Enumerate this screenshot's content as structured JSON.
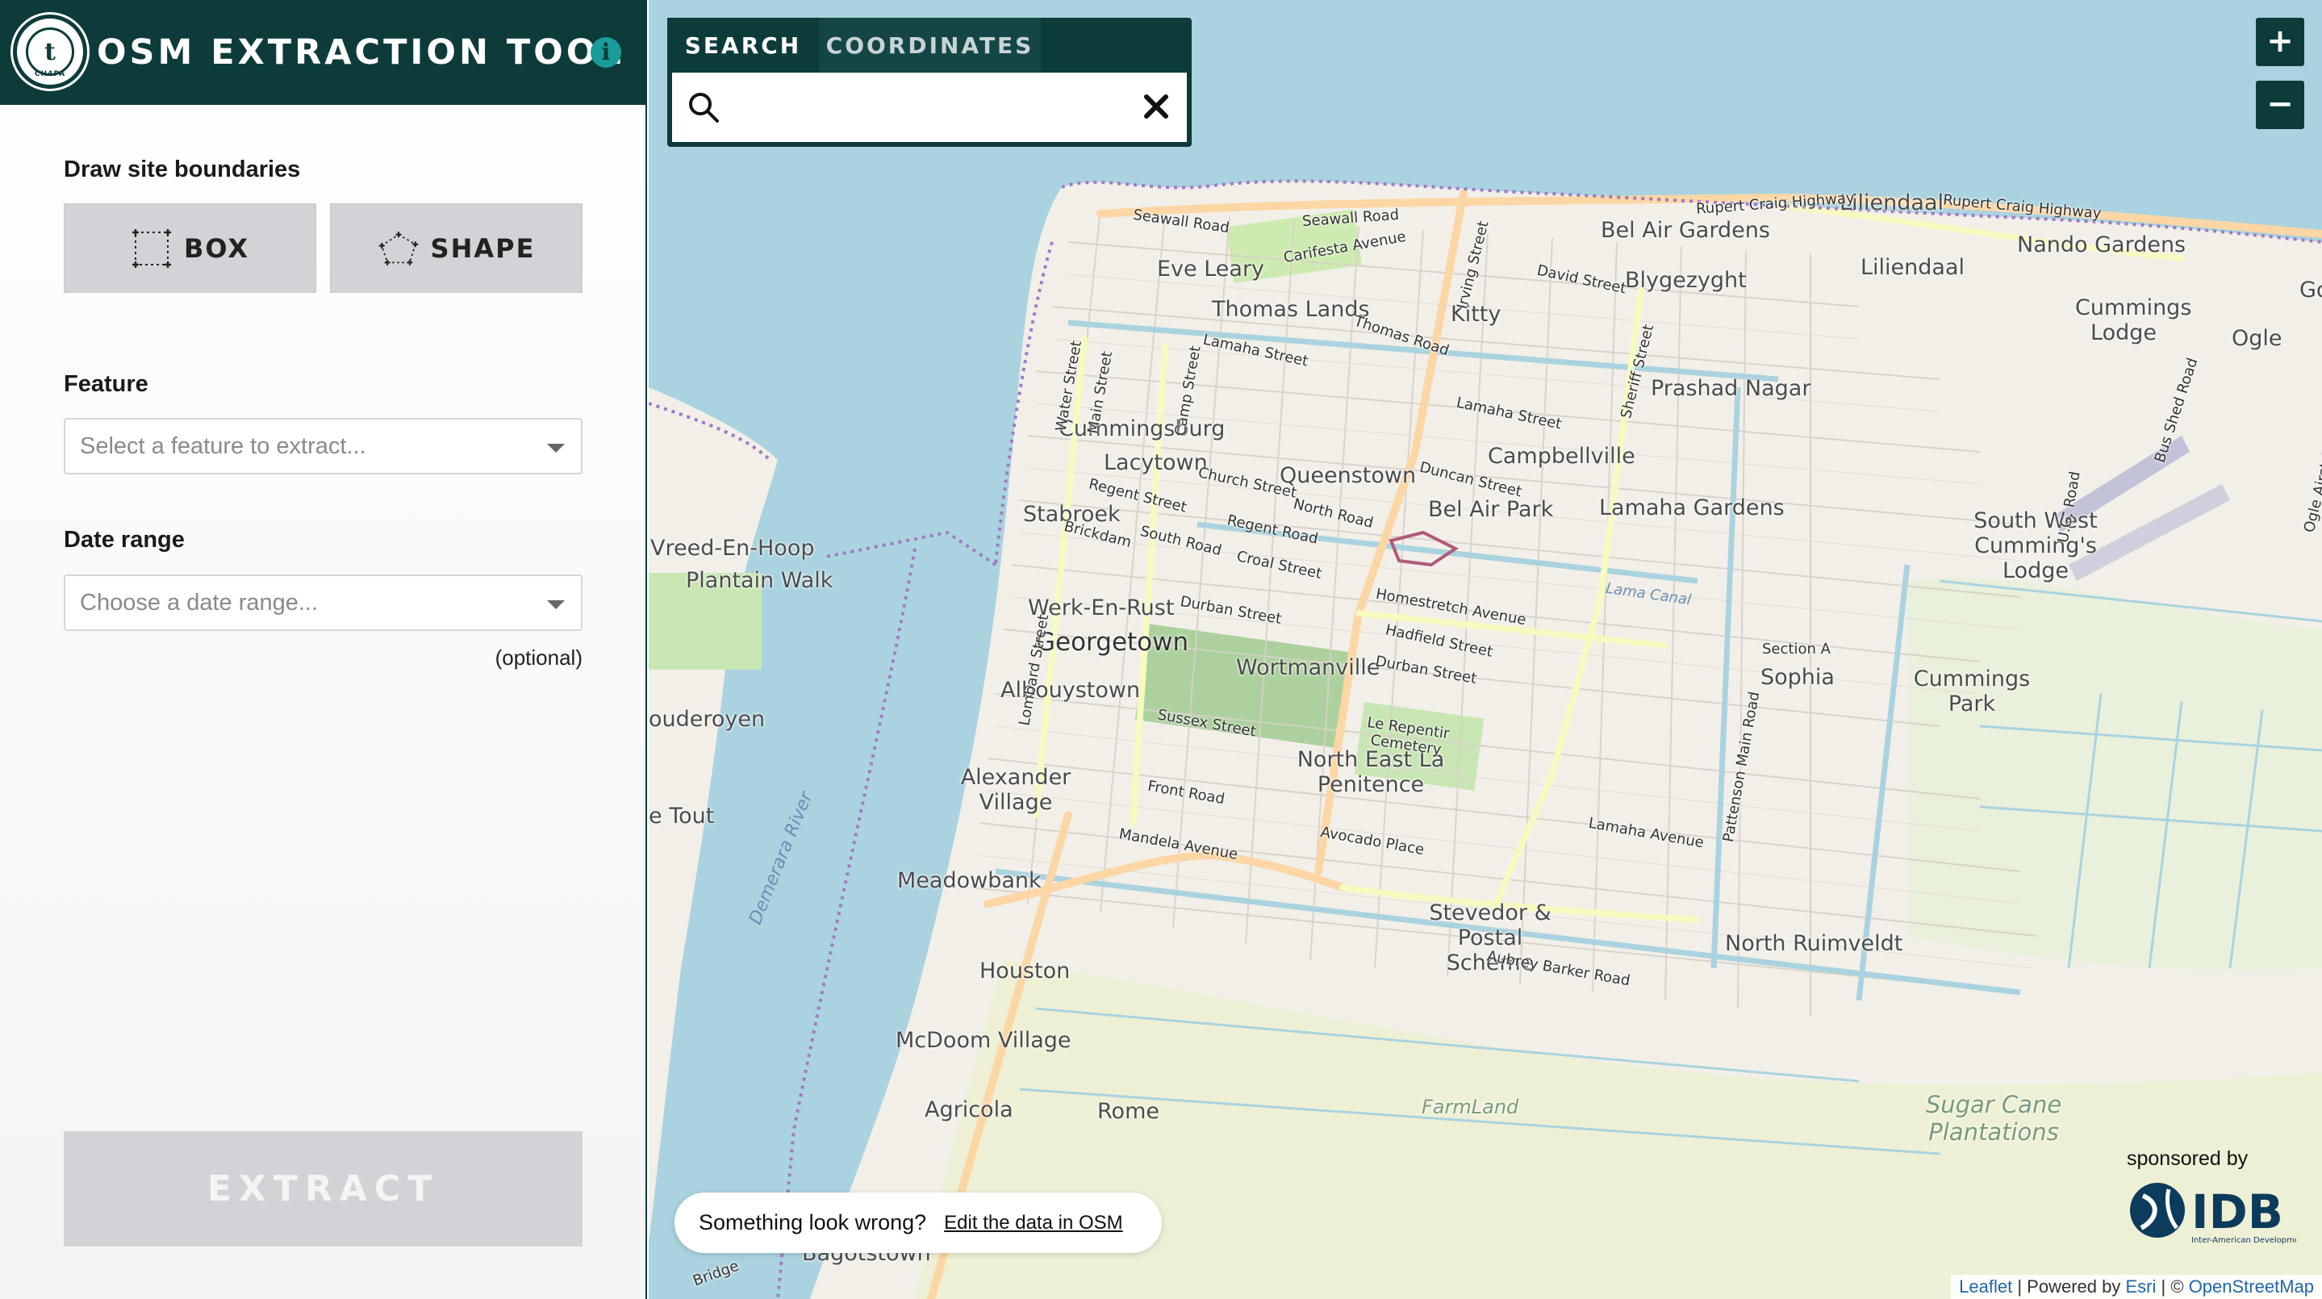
{
  "app": {
    "title": "OSM EXTRACTION TOOL",
    "logo_text": "CH4PA",
    "info_icon": "info-icon"
  },
  "sidebar": {
    "draw_label": "Draw site boundaries",
    "box_button": "BOX",
    "shape_button": "SHAPE",
    "feature_label": "Feature",
    "feature_placeholder": "Select a feature to extract...",
    "date_label": "Date range",
    "date_placeholder": "Choose a date range...",
    "optional_note": "(optional)",
    "extract_button": "EXTRACT"
  },
  "search": {
    "tab_search": "SEARCH",
    "tab_coordinates": "COORDINATES",
    "active_tab": "SEARCH",
    "value": "",
    "search_icon": "search-icon",
    "clear_icon": "close-icon"
  },
  "zoom": {
    "in_label": "+",
    "out_label": "−"
  },
  "feedback": {
    "text": "Something look wrong?",
    "link": "Edit the data in OSM"
  },
  "sponsor": {
    "label": "sponsored by",
    "logo_text": "IDB",
    "logo_subtext": "Inter-American Development Bank"
  },
  "attribution": {
    "leaflet": "Leaflet",
    "powered_prefix": "| Powered by",
    "esri": "Esri",
    "copyright": "| ©",
    "osm": "OpenStreetMap"
  },
  "map_labels": {
    "georgetown": "Georgetown",
    "cummingsburg": "Cummingsburg",
    "lacytown": "Lacytown",
    "stabroek": "Stabroek",
    "werk_en_rust": "Werk-En-Rust",
    "albouystown": "Albouystown",
    "queenstown": "Queenstown",
    "bel_air_park": "Bel Air Park",
    "campbellville": "Campbellville",
    "kitty": "Kitty",
    "thomas_lands": "Thomas Lands",
    "eve_leary": "Eve Leary",
    "bel_air_gardens": "Bel Air Gardens",
    "blygezyght": "Blygezyght",
    "prashad_nagar": "Prashad Nagar",
    "lamaha_gardens": "Lamaha Gardens",
    "liliendaal": "Liliendaal",
    "liliendaal_top": "Liliendaal",
    "nando_gardens": "Nando Gardens",
    "cummings_lodge": "Cummings Lodge",
    "ogle": "Ogle",
    "south_west_cummings_lodge": "South West Cumming's Lodge",
    "cummings_park": "Cummings Park",
    "sophia": "Sophia",
    "section_a": "Section A",
    "wortmanville": "Wortmanville",
    "north_east_la_penitence": "North East La Penitence",
    "alexander_village": "Alexander Village",
    "meadowbank": "Meadowbank",
    "houston": "Houston",
    "mcdoom_village": "McDoom Village",
    "agricola": "Agricola",
    "rome": "Rome",
    "stevedor": "Stevedor & Postal Scheme",
    "north_ruimveldt": "North Ruimveldt",
    "bagotstown": "Bagotstown",
    "vreed_en_hoop": "Vreed-En-Hoop",
    "plantain_walk": "Plantain Walk",
    "ouderoyen": "ouderoyen",
    "e_tout": "e Tout",
    "farmland": "FarmLand",
    "sugar_cane": "Sugar Cane Plantations",
    "demerara_river": "Demerara River",
    "lama_canal": "Lama Canal",
    "le_repentir": "Le Repentir Cemetery",
    "rupert_craig": "Rupert Craig Highway",
    "seawall_road": "Seawall Road",
    "carifesta": "Carifesta Avenue",
    "mandela": "Mandela Avenue",
    "homestretch": "Homestretch Avenue",
    "lamaha_street": "Lamaha Street",
    "regent_road": "Regent Road",
    "sussex_street": "Sussex Street",
    "durban_street": "Durban Street",
    "front_road": "Front Road",
    "avocado_place": "Avocado Place",
    "aubrey_barker": "Aubrey Barker Road",
    "lamaha_avenue": "Lamaha Avenue",
    "david_street": "David Street",
    "sheriff_street": "Sheriff Street",
    "irving_street": "Irving Street",
    "camp_street": "Camp Street",
    "main_street": "Main Street",
    "water_street": "Water Street",
    "lombard_street": "Lombard Street",
    "church_street": "Church Street",
    "croal_street": "Croal Street",
    "duncan_street": "Duncan Street",
    "hadfield_street": "Hadfield Street",
    "north_road": "North Road",
    "south_road": "South Road",
    "brickdam": "Brickdam",
    "regent_street": "Regent Street",
    "thomas_road": "Thomas Road",
    "pattenson_main": "Pattenson Main Road",
    "ug_road": "U.G. Road",
    "bus_shed_road": "Bus Shed Road",
    "ogle_airstrip": "Ogle Airstrip Road",
    "bridge": "Bridge",
    "goed": "Goed"
  }
}
